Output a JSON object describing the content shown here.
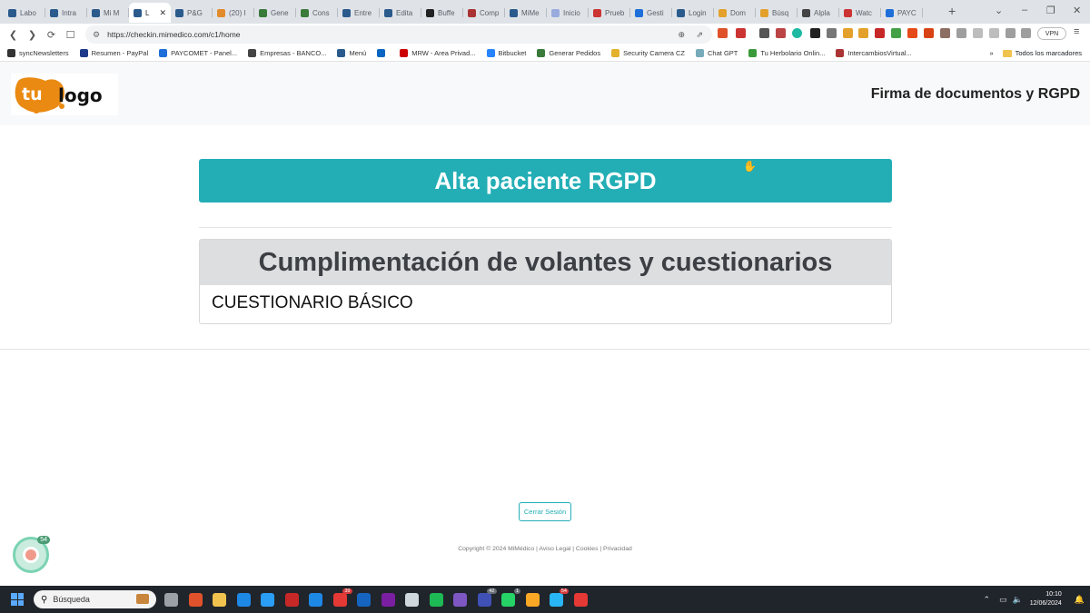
{
  "browser": {
    "tabs": [
      {
        "label": "Labo",
        "color": "#2b5b8c"
      },
      {
        "label": "Intra",
        "color": "#2b5b8c"
      },
      {
        "label": "Mi M",
        "color": "#2b5b8c"
      },
      {
        "label": "L",
        "color": "#2b5b8c",
        "active": true
      },
      {
        "label": "P&G",
        "color": "#2b5b8c"
      },
      {
        "label": "(20) I",
        "color": "#e38b2c"
      },
      {
        "label": "Gene",
        "color": "#3a7a3a"
      },
      {
        "label": "Cons",
        "color": "#3a7a3a"
      },
      {
        "label": "Entre",
        "color": "#2b5b8c"
      },
      {
        "label": "Edita",
        "color": "#2b5b8c"
      },
      {
        "label": "Buffe",
        "color": "#222222"
      },
      {
        "label": "Comp",
        "color": "#a33"
      },
      {
        "label": "MiMe",
        "color": "#2b5b8c"
      },
      {
        "label": "Inicio",
        "color": "#9ad"
      },
      {
        "label": "Prueb",
        "color": "#c33"
      },
      {
        "label": "Gesti",
        "color": "#1e6fd9"
      },
      {
        "label": "Login",
        "color": "#2b5b8c"
      },
      {
        "label": "Dom",
        "color": "#e3a12c"
      },
      {
        "label": "Búsq",
        "color": "#e3a12c"
      },
      {
        "label": "Alpla",
        "color": "#444"
      },
      {
        "label": "Watc",
        "color": "#c33"
      },
      {
        "label": "PAYC",
        "color": "#1e6fd9"
      }
    ],
    "url": "https://checkin.mimedico.com/c1/home",
    "vpn_label": "VPN",
    "bookmarks": [
      {
        "label": "syncNewsletters",
        "color": "#333"
      },
      {
        "label": "Resumen - PayPal",
        "color": "#1e3a8a"
      },
      {
        "label": "PAYCOMET - Panel...",
        "color": "#1e6fd9"
      },
      {
        "label": "Empresas - BANCO...",
        "color": "#444"
      },
      {
        "label": "Menú",
        "color": "#2b5b8c"
      },
      {
        "label": "",
        "color": "#0a66c2"
      },
      {
        "label": "MRW - Area Privad...",
        "color": "#c00"
      },
      {
        "label": "Bitbucket",
        "color": "#2684ff"
      },
      {
        "label": "Generar Pedidos",
        "color": "#3a7a3a"
      },
      {
        "label": "Security Camera CZ",
        "color": "#e3b12c"
      },
      {
        "label": "Chat GPT",
        "color": "#7ab"
      },
      {
        "label": "Tu Herbolario Onlin...",
        "color": "#3a9a3a"
      },
      {
        "label": "IntercambiosVirtual...",
        "color": "#a33"
      }
    ],
    "bookmarks_folder": "Todos los marcadores"
  },
  "header": {
    "logo_alt": "tulogo",
    "title": "Firma de documentos y RGPD"
  },
  "main": {
    "banner_title": "Alta paciente RGPD",
    "card_title": "Cumplimentación de volantes y cuestionarios",
    "card_item": "CUESTIONARIO BÁSICO"
  },
  "actions": {
    "logout_label": "Cerrar Sesión"
  },
  "footer": {
    "text": "Copyright © 2024 MiMédico | Aviso Legal | Cookies | Privacidad"
  },
  "widget": {
    "badge": "54"
  },
  "taskbar": {
    "search_placeholder": "Búsqueda",
    "apps": [
      {
        "name": "task-view",
        "color": "#9aa0a6",
        "count": ""
      },
      {
        "name": "brave",
        "color": "#e0522b",
        "count": ""
      },
      {
        "name": "file-explorer",
        "color": "#f0c34e",
        "count": ""
      },
      {
        "name": "edge",
        "color": "#1e88e5",
        "count": ""
      },
      {
        "name": "app-blue",
        "color": "#2a9df4",
        "count": ""
      },
      {
        "name": "app-red",
        "color": "#c62828",
        "count": ""
      },
      {
        "name": "vscode",
        "color": "#1e88e5",
        "count": ""
      },
      {
        "name": "app-notify",
        "color": "#e53935",
        "count": "39"
      },
      {
        "name": "app-outlook",
        "color": "#1565c0",
        "count": ""
      },
      {
        "name": "onenote",
        "color": "#7b1fa2",
        "count": ""
      },
      {
        "name": "app-mail",
        "color": "#cfd8dc",
        "count": ""
      },
      {
        "name": "spotify",
        "color": "#1db954",
        "count": ""
      },
      {
        "name": "app-purple",
        "color": "#7e57c2",
        "count": ""
      },
      {
        "name": "app-teams",
        "color": "#3f51b5",
        "count": "42"
      },
      {
        "name": "whatsapp",
        "color": "#25d366",
        "count": "1"
      },
      {
        "name": "app-yellow",
        "color": "#f9a825",
        "count": ""
      },
      {
        "name": "telegram",
        "color": "#29b6f6",
        "count": "54"
      },
      {
        "name": "app-red2",
        "color": "#e53935",
        "count": ""
      }
    ],
    "time": "10:10",
    "date": "12/06/2024"
  },
  "colors": {
    "accent": "#23aeb6",
    "card_header_bg": "#dcdee0",
    "header_bg": "#f8f9fa"
  }
}
